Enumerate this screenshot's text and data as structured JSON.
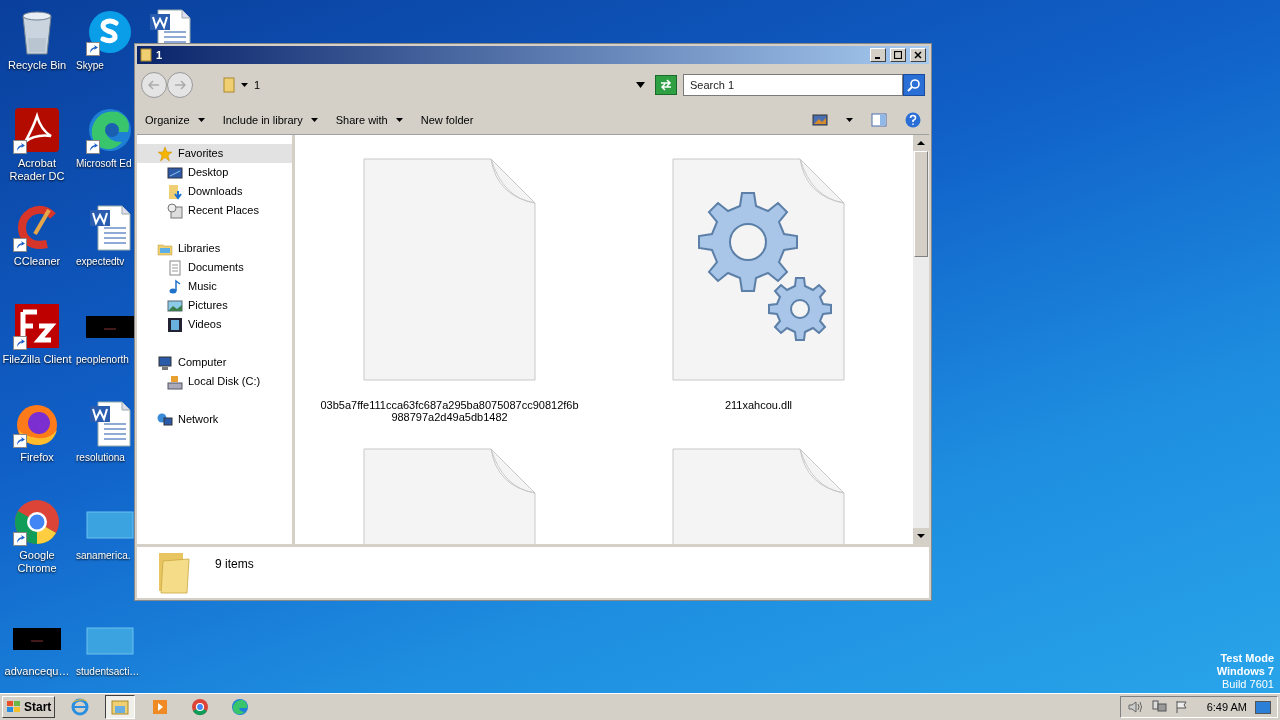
{
  "desktop_columns": [
    {
      "icons": [
        {
          "kind": "recycle",
          "label": "Recycle Bin",
          "shortcut": false
        },
        {
          "kind": "acrobat",
          "label": "Acrobat Reader DC",
          "shortcut": true
        },
        {
          "kind": "ccleaner",
          "label": "CCleaner",
          "shortcut": true
        },
        {
          "kind": "filezilla",
          "label": "FileZilla Client",
          "shortcut": true
        },
        {
          "kind": "firefox",
          "label": "Firefox",
          "shortcut": true
        },
        {
          "kind": "chrome",
          "label": "Google Chrome",
          "shortcut": true
        },
        {
          "kind": "dark-thumb",
          "label": "advancequ…",
          "shortcut": false
        }
      ]
    },
    {
      "icons": [
        {
          "kind": "skype",
          "label": "Skype",
          "shortcut": true
        },
        {
          "kind": "edge",
          "label": "Microsoft Ed",
          "shortcut": true
        },
        {
          "kind": "word",
          "label": "expectedtv",
          "shortcut": false
        },
        {
          "kind": "dark-thumb",
          "label": "peoplenorth",
          "shortcut": false
        },
        {
          "kind": "word",
          "label": "resolutiona",
          "shortcut": false
        },
        {
          "kind": "light-thumb",
          "label": "sanamerica.",
          "shortcut": false
        },
        {
          "kind": "light-thumb",
          "label": "studentsacti…",
          "shortcut": false
        }
      ]
    },
    {
      "icons": [
        {
          "kind": "word",
          "shortcut": false
        }
      ]
    }
  ],
  "window": {
    "title": "1",
    "address": "1",
    "search": {
      "placeholder": "Search 1"
    },
    "toolbar": [
      {
        "label": "Organize",
        "dropdown": true
      },
      {
        "label": "Include in library",
        "dropdown": true
      },
      {
        "label": "Share with",
        "dropdown": true
      },
      {
        "label": "New folder",
        "dropdown": false
      }
    ],
    "nav": [
      {
        "label": "Favorites",
        "kind": "star",
        "selected": true,
        "children": [
          {
            "label": "Desktop",
            "kind": "desktop",
            "selected": false
          },
          {
            "label": "Downloads",
            "kind": "downloads",
            "selected": false
          },
          {
            "label": "Recent Places",
            "kind": "recent",
            "selected": false
          }
        ]
      },
      {
        "label": "Libraries",
        "kind": "library",
        "selected": false,
        "children": [
          {
            "label": "Documents",
            "kind": "documents",
            "selected": false
          },
          {
            "label": "Music",
            "kind": "music",
            "selected": false
          },
          {
            "label": "Pictures",
            "kind": "pictures",
            "selected": false
          },
          {
            "label": "Videos",
            "kind": "videos",
            "selected": false
          }
        ]
      },
      {
        "label": "Computer",
        "kind": "computer",
        "selected": false,
        "children": [
          {
            "label": "Local Disk (C:)",
            "kind": "disk",
            "selected": false
          }
        ]
      },
      {
        "label": "Network",
        "kind": "network",
        "selected": false
      }
    ],
    "files": [
      {
        "kind": "blank",
        "name": "03b5a7ffe111cca63fc687a295ba8075087cc90812f6b988797a2d49a5db1482"
      },
      {
        "kind": "gear",
        "name": "211xahcou.dll"
      },
      {
        "kind": "blank"
      },
      {
        "kind": "blank"
      }
    ],
    "details": {
      "count": "9 items"
    }
  },
  "system_text": [
    {
      "text": "Test Mode",
      "bold": true
    },
    {
      "text": "Windows 7",
      "bold": true
    },
    {
      "text": "Build 7601",
      "bold": false
    }
  ],
  "taskbar": {
    "start": "Start",
    "apps": [
      {
        "kind": "ie",
        "selected": false
      },
      {
        "kind": "explorer",
        "selected": true
      },
      {
        "kind": "media",
        "selected": false
      },
      {
        "kind": "chrome",
        "selected": false
      },
      {
        "kind": "edge",
        "selected": false
      }
    ],
    "clock": "6:49 AM"
  }
}
